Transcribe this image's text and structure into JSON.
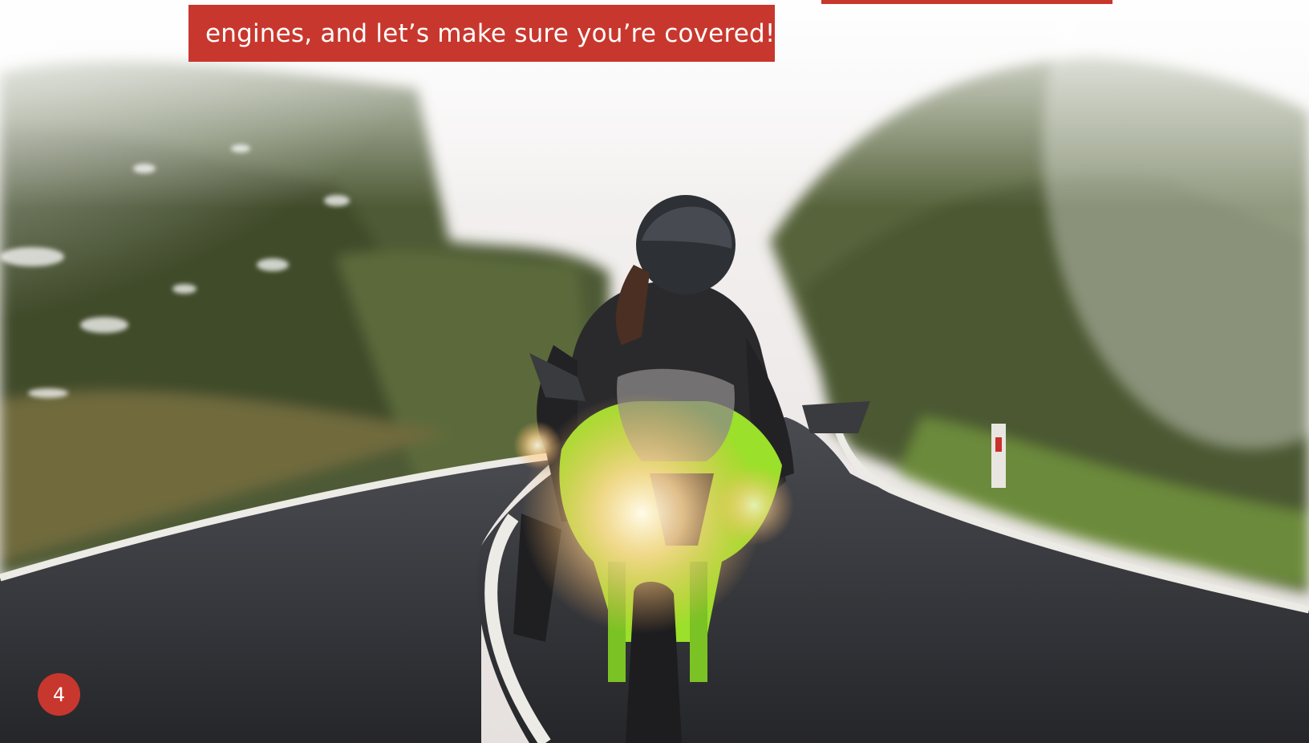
{
  "slide": {
    "caption": "engines, and let’s make sure you’re covered!",
    "page_number": "4"
  },
  "colors": {
    "accent": "#c8372d",
    "bike_green": "#9be02a",
    "asphalt": "#2e2f34",
    "foliage": "#5d6b3a",
    "sky": "#efeceb"
  },
  "scene": {
    "subject": "motorcyclist-on-green-sport-bike",
    "background": "blurred-forest-road-in-fog"
  }
}
